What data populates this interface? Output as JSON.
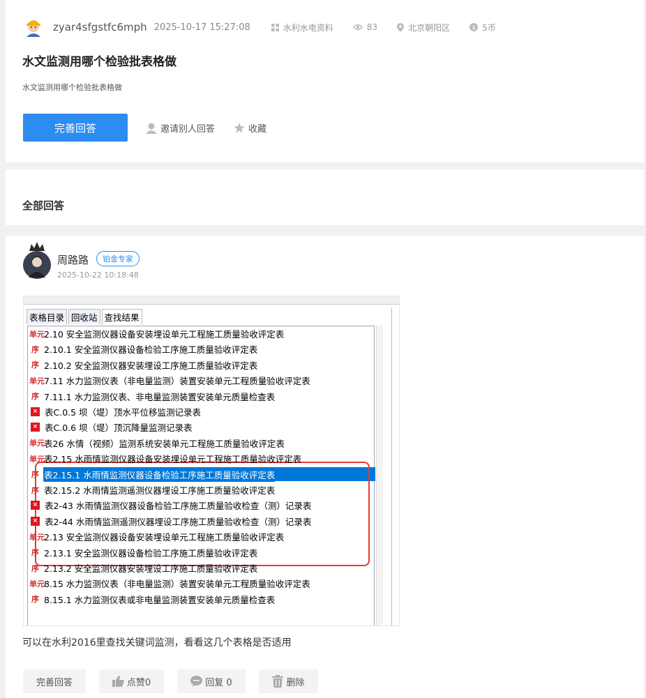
{
  "question": {
    "username": "zyar4sfgstfc6mph",
    "time": "2025-10-17 15:27:08",
    "category": "水利水电资料",
    "views": "83",
    "location": "北京朝阳区",
    "reward": "5币",
    "title": "水文监测用哪个检验批表格做",
    "description": "水文监测用哪个检验批表格做",
    "primary_button": "完善回答",
    "invite_label": "邀请别人回答",
    "collect_label": "收藏"
  },
  "all_answers_title": "全部回答",
  "answer": {
    "name": "周路路",
    "badge": "铂金专家",
    "time": "2025-10-22 10:18:48",
    "text": "可以在水利2016里查找关键词监测，看看这几个表格是否适用",
    "actions": {
      "improve": "完善回答",
      "like": "点赞0",
      "reply": "回复 0",
      "delete": "删除"
    },
    "screenshot": {
      "tabs": [
        "表格目录",
        "回收站",
        "查找结果"
      ],
      "rows": [
        {
          "icon": "单元",
          "label": "2.10 安全监测仪器设备安装埋设单元工程施工质量验收评定表"
        },
        {
          "icon": "序",
          "label": "2.10.1 安全监测仪器设备检验工序施工质量验收评定表"
        },
        {
          "icon": "序",
          "label": "2.10.2 安全监测仪器安装埋设工序施工质量验收评定表"
        },
        {
          "icon": "单元",
          "label": "7.11 水力监测仪表（非电量监测）装置安装单元工程质量验收评定表"
        },
        {
          "icon": "序",
          "label": "7.11.1 水力监测仪表、非电量监测装置安装单元质量检查表"
        },
        {
          "icon": "box",
          "label": "表C.0.5 坝（堤）顶水平位移监测记录表"
        },
        {
          "icon": "box",
          "label": "表C.0.6 坝（堤）顶沉降量监测记录表"
        },
        {
          "icon": "单元",
          "label": "表26 水情（视频）监测系统安装单元工程施工质量验收评定表"
        },
        {
          "icon": "单元",
          "label": "表2.15 水雨情监测仪器设备安装埋设单元工程施工质量验收评定表"
        },
        {
          "icon": "序",
          "label": "表2.15.1 水雨情监测仪器设备检验工序施工质量验收评定表"
        },
        {
          "icon": "序",
          "label": "表2.15.2 水雨情监测遥测仪器埋设工序施工质量验收评定表"
        },
        {
          "icon": "box",
          "label": "表2-43 水雨情监测仪器设备检验工序施工质量验收检查（测）记录表"
        },
        {
          "icon": "box",
          "label": "表2-44 水雨情监测遥测仪器埋设工序施工质量验收检查（测）记录表"
        },
        {
          "icon": "单元",
          "label": "2.13 安全监测仪器设备安装埋设单元工程施工质量验收评定表"
        },
        {
          "icon": "序",
          "label": "2.13.1 安全监测仪器设备检验工序施工质量验收评定表"
        },
        {
          "icon": "序",
          "label": "2.13.2 安全监测仪器安装埋设工序施工质量验收评定表"
        },
        {
          "icon": "单元",
          "label": "8.15 水力监测仪表（非电量监测）装置安装单元工程质量验收评定表"
        },
        {
          "icon": "序",
          "label": "8.15.1 水力监测仪表或非电量监测装置安装单元质量检查表"
        }
      ],
      "selected_row": 9
    }
  }
}
